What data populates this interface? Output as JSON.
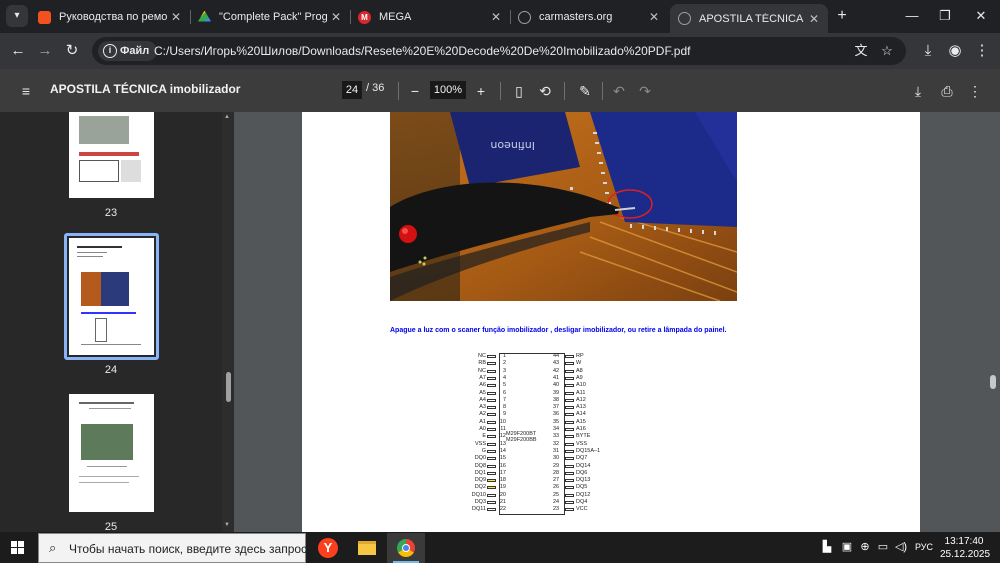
{
  "browser": {
    "tabs": [
      {
        "title": "Руководства по ремонту",
        "favicon_color": "#f4511e",
        "active": false
      },
      {
        "title": "\"Complete Pack\" Program",
        "favicon_color": "#34a853",
        "active": false
      },
      {
        "title": "MEGA",
        "favicon_color": "#d9272e",
        "active": false
      },
      {
        "title": "carmasters.org",
        "favicon_color": "#9aa0a6",
        "active": false
      },
      {
        "title": "APOSTILA TÉCNICA imobi",
        "favicon_color": "#9aa0a6",
        "active": true
      }
    ],
    "address": {
      "chip_label": "Файл",
      "url": "C:/Users/Игорь%20Шилов/Downloads/Resete%20E%20Decode%20De%20Imobilizado%20PDF.pdf"
    }
  },
  "pdf": {
    "title": "APOSTILA TÉCNICA imobilizador",
    "current_page": "24",
    "total_pages": "/ 36",
    "zoom": "100%"
  },
  "sidebar": {
    "thumbnails": [
      {
        "number": "23"
      },
      {
        "number": "24",
        "selected": true
      },
      {
        "number": "25"
      }
    ]
  },
  "page_content": {
    "caption": "Apague a luz com o scaner função imobilizador , desligar imobilizador, ou retire a lâmpada do painel.",
    "photo_chip_text": "Infineon",
    "chip_name": [
      "M29F200BT",
      "M29F200BB"
    ],
    "pins_left": [
      {
        "label": "NC",
        "num": "1"
      },
      {
        "label": "RB",
        "num": "2"
      },
      {
        "label": "NC",
        "num": "3"
      },
      {
        "label": "A7",
        "num": "4"
      },
      {
        "label": "A6",
        "num": "5"
      },
      {
        "label": "A5",
        "num": "6"
      },
      {
        "label": "A4",
        "num": "7"
      },
      {
        "label": "A3",
        "num": "8"
      },
      {
        "label": "A2",
        "num": "9"
      },
      {
        "label": "A1",
        "num": "10"
      },
      {
        "label": "A0",
        "num": "11"
      },
      {
        "label": "E",
        "num": "12"
      },
      {
        "label": "VSS",
        "num": "13"
      },
      {
        "label": "G",
        "num": "14"
      },
      {
        "label": "DQ0",
        "num": "15"
      },
      {
        "label": "DQ8",
        "num": "16"
      },
      {
        "label": "DQ1",
        "num": "17"
      },
      {
        "label": "DQ9",
        "num": "18",
        "highlight": true
      },
      {
        "label": "DQ2",
        "num": "19",
        "highlight": true
      },
      {
        "label": "DQ10",
        "num": "20"
      },
      {
        "label": "DQ3",
        "num": "21"
      },
      {
        "label": "DQ11",
        "num": "22"
      }
    ],
    "pins_right": [
      {
        "label": "RP",
        "num": "44"
      },
      {
        "label": "W",
        "num": "43"
      },
      {
        "label": "A8",
        "num": "42"
      },
      {
        "label": "A9",
        "num": "41"
      },
      {
        "label": "A10",
        "num": "40"
      },
      {
        "label": "A11",
        "num": "39"
      },
      {
        "label": "A12",
        "num": "38"
      },
      {
        "label": "A13",
        "num": "37"
      },
      {
        "label": "A14",
        "num": "36"
      },
      {
        "label": "A15",
        "num": "35"
      },
      {
        "label": "A16",
        "num": "34"
      },
      {
        "label": "BYTE",
        "num": "33"
      },
      {
        "label": "VSS",
        "num": "32"
      },
      {
        "label": "DQ15A–1",
        "num": "31"
      },
      {
        "label": "DQ7",
        "num": "30"
      },
      {
        "label": "DQ14",
        "num": "29"
      },
      {
        "label": "DQ6",
        "num": "28"
      },
      {
        "label": "DQ13",
        "num": "27"
      },
      {
        "label": "DQ5",
        "num": "26"
      },
      {
        "label": "DQ12",
        "num": "25"
      },
      {
        "label": "DQ4",
        "num": "24"
      },
      {
        "label": "VCC",
        "num": "23"
      }
    ]
  },
  "taskbar": {
    "search_placeholder": "Чтобы начать поиск, введите здесь запрос",
    "language": "РУС",
    "time": "13:17:40",
    "date": "25.12.2025"
  },
  "colors": {
    "accent": "#8ab4f8",
    "caption_blue": "#0000ee",
    "pin_highlight": "#ffe24a"
  }
}
